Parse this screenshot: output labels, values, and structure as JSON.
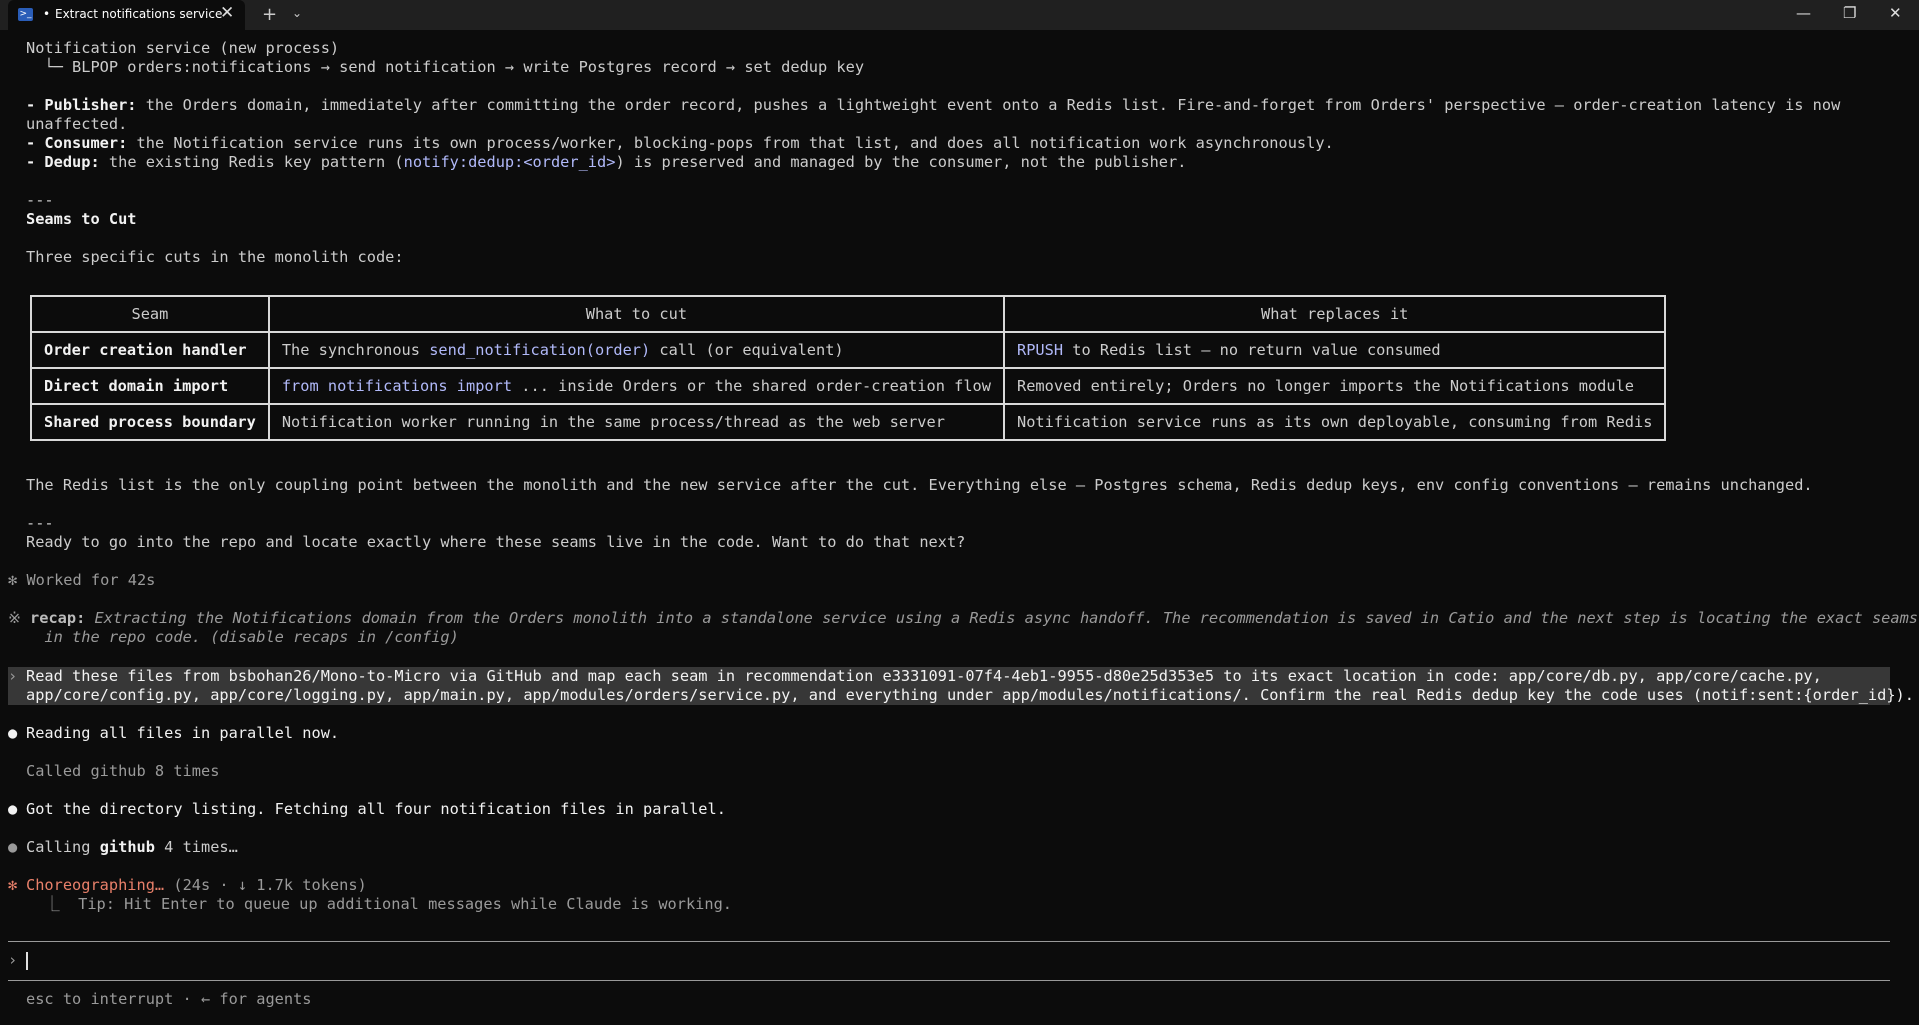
{
  "window": {
    "tab_title": "Extract notifications service",
    "tab_dot": "•",
    "ps_icon": ">_",
    "close_glyph": "✕",
    "new_tab_glyph": "+",
    "dropdown_glyph": "⌄",
    "minimize_glyph": "—",
    "maximize_glyph": "❐",
    "window_close_glyph": "✕"
  },
  "flow": {
    "line1": "Notification service (new process)",
    "line2": "  └─ BLPOP orders:notifications → send notification → write Postgres record → set dedup key"
  },
  "bullets": {
    "publisher_label": "- Publisher:",
    "publisher_text": " the Orders domain, immediately after committing the order record, pushes a lightweight event onto a Redis list. Fire-and-forget from Orders' perspective — order-creation latency is now",
    "publisher_cont": "unaffected.",
    "consumer_label": "- Consumer:",
    "consumer_text": " the Notification service runs its own process/worker, blocking-pops from that list, and does all notification work asynchronously.",
    "dedup_label": "- Dedup:",
    "dedup_pre": " the existing Redis key pattern (",
    "dedup_code": "notify:dedup:<order_id>",
    "dedup_post": ") is preserved and managed by the consumer, not the publisher."
  },
  "separator": "---",
  "seams": {
    "heading": "Seams to Cut",
    "intro": "Three specific cuts in the monolith code:",
    "headers": [
      "Seam",
      "What to cut",
      "What replaces it"
    ],
    "rows": [
      {
        "seam": "Order creation handler",
        "cut_pre": "The synchronous ",
        "cut_code": "send_notification(order)",
        "cut_post": " call (or equivalent)",
        "replace_code": "RPUSH",
        "replace_post": " to Redis list — no return value consumed"
      },
      {
        "seam": "Direct domain import",
        "cut_pre": "",
        "cut_code": "from notifications import",
        "cut_post": " ... inside Orders or the shared order-creation flow",
        "replace_code": "",
        "replace_post": "Removed entirely; Orders no longer imports the Notifications module"
      },
      {
        "seam": "Shared process boundary",
        "cut_pre": "Notification worker running in the same process/thread as the web server",
        "cut_code": "",
        "cut_post": "",
        "replace_code": "",
        "replace_post": "Notification service runs as its own deployable, consuming from Redis"
      }
    ]
  },
  "summary": "The Redis list is the only coupling point between the monolith and the new service after the cut. Everything else — Postgres schema, Redis dedup keys, env config conventions — remains unchanged.",
  "next_step": "Ready to go into the repo and locate exactly where these seams live in the code. Want to do that next?",
  "worked": {
    "marker": "✻",
    "text": "Worked for 42s"
  },
  "recap": {
    "marker": "※",
    "label": "recap:",
    "line1": " Extracting the Notifications domain from the Orders monolith into a standalone service using a Redis async handoff. The recommendation is saved in Catio and the next step is locating the exact seams",
    "line2": "in the repo code. (disable recaps in /config)"
  },
  "user_message": {
    "marker": "›",
    "line1": "Read these files from bsbohan26/Mono-to-Micro via GitHub and map each seam in recommendation e3331091-07f4-4eb1-9955-d80e25d353e5 to its exact location in code: app/core/db.py, app/core/cache.py,",
    "line2": "app/core/config.py, app/core/logging.py, app/main.py, app/modules/orders/service.py, and everything under app/modules/notifications/. Confirm the real Redis dedup key the code uses (notif:sent:{order_id})."
  },
  "activity": [
    {
      "marker": "●",
      "text": "Reading all files in parallel now."
    },
    {
      "marker": "",
      "text": "Called github 8 times"
    },
    {
      "marker": "●",
      "text": "Got the directory listing. Fetching all four notification files in parallel."
    },
    {
      "marker": "●",
      "pre": "Calling ",
      "bold": "github",
      "post": " 4 times…"
    }
  ],
  "status": {
    "marker": "✻",
    "label": "Choreographing…",
    "meta": " (24s · ↓ 1.7k tokens)",
    "tip": "  ⎿  Tip: Hit Enter to queue up additional messages while Claude is working."
  },
  "prompt": {
    "caret": "›",
    "value": ""
  },
  "footer": "esc to interrupt · ← for agents"
}
